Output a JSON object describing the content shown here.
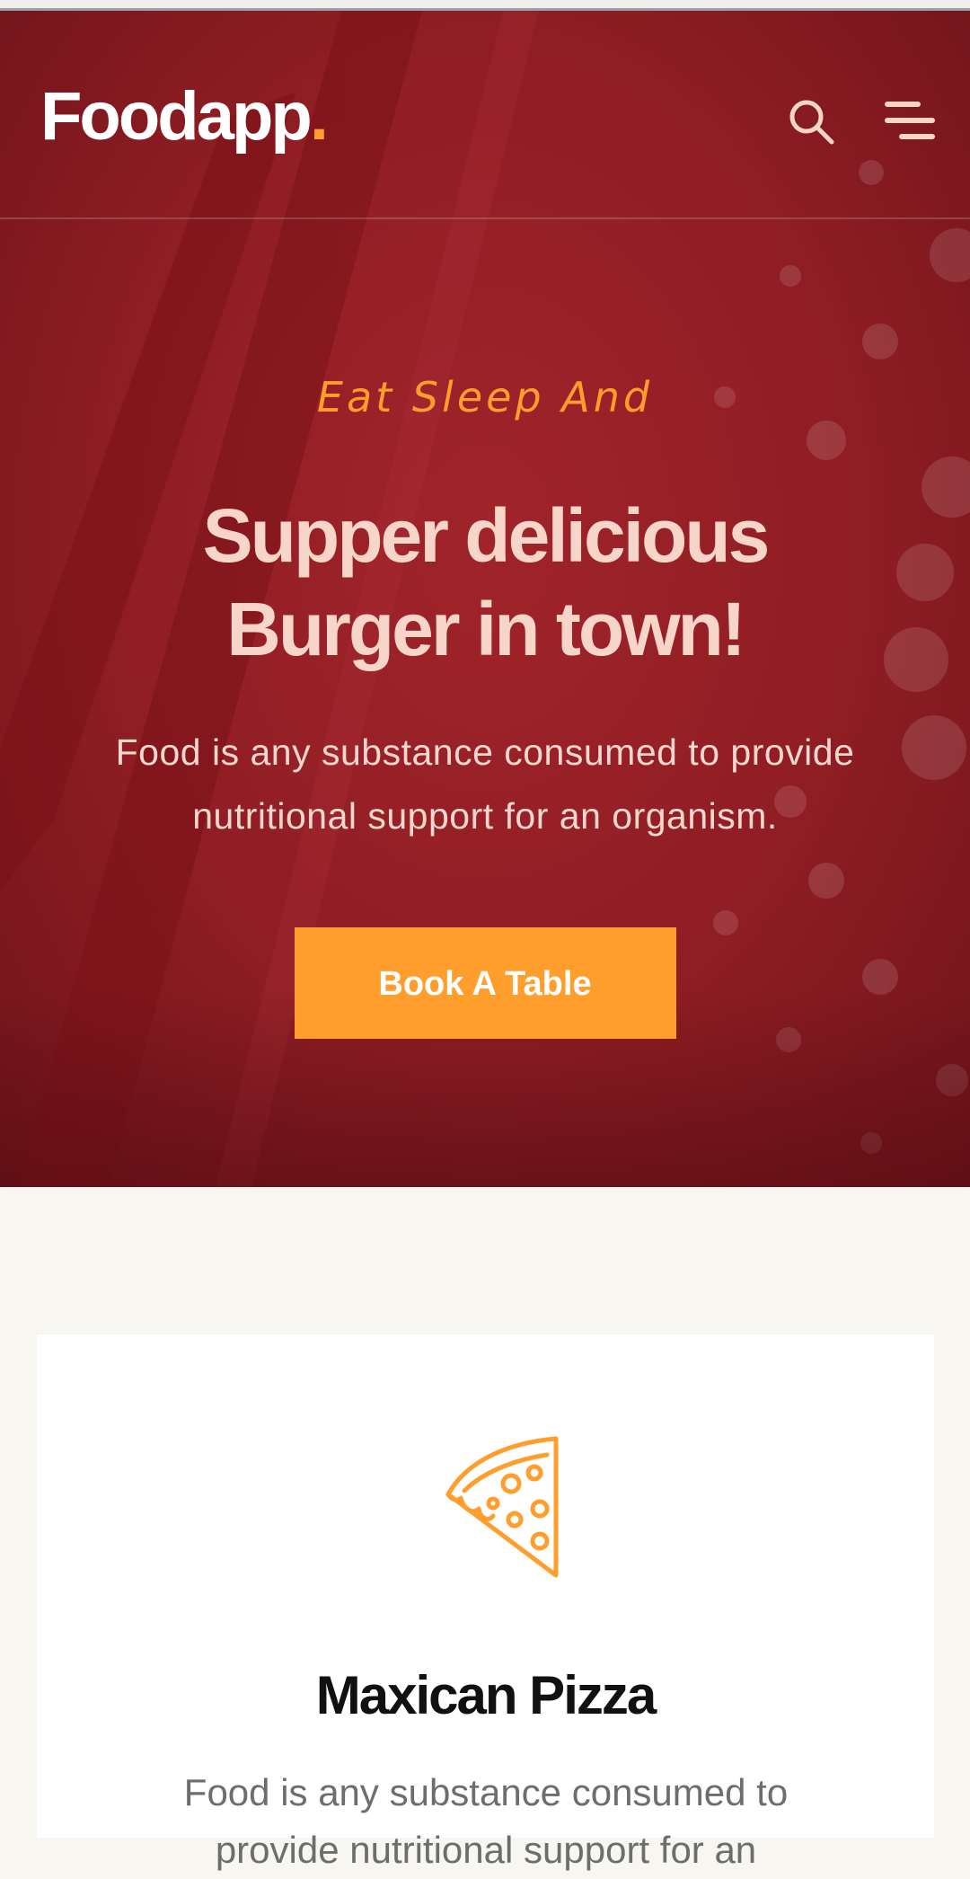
{
  "colors": {
    "hero_bg": "#8f1d24",
    "accent": "#ff9e2c",
    "headline_text": "#f7d5c8",
    "page_bg": "#f8f6f1"
  },
  "header": {
    "logo_text": "Foodapp",
    "logo_dot": ".",
    "search_icon": "search-icon",
    "menu_icon": "hamburger-menu-icon"
  },
  "hero": {
    "tagline": "Eat Sleep And",
    "headline_line1": "Supper delicious",
    "headline_line2": "Burger in town!",
    "description": "Food is any substance consumed to provide nutritional support for an organism.",
    "cta_label": "Book A Table"
  },
  "feature_card": {
    "icon": "pizza-slice-icon",
    "title": "Maxican Pizza",
    "text": "Food is any substance consumed to provide nutritional support for an"
  }
}
